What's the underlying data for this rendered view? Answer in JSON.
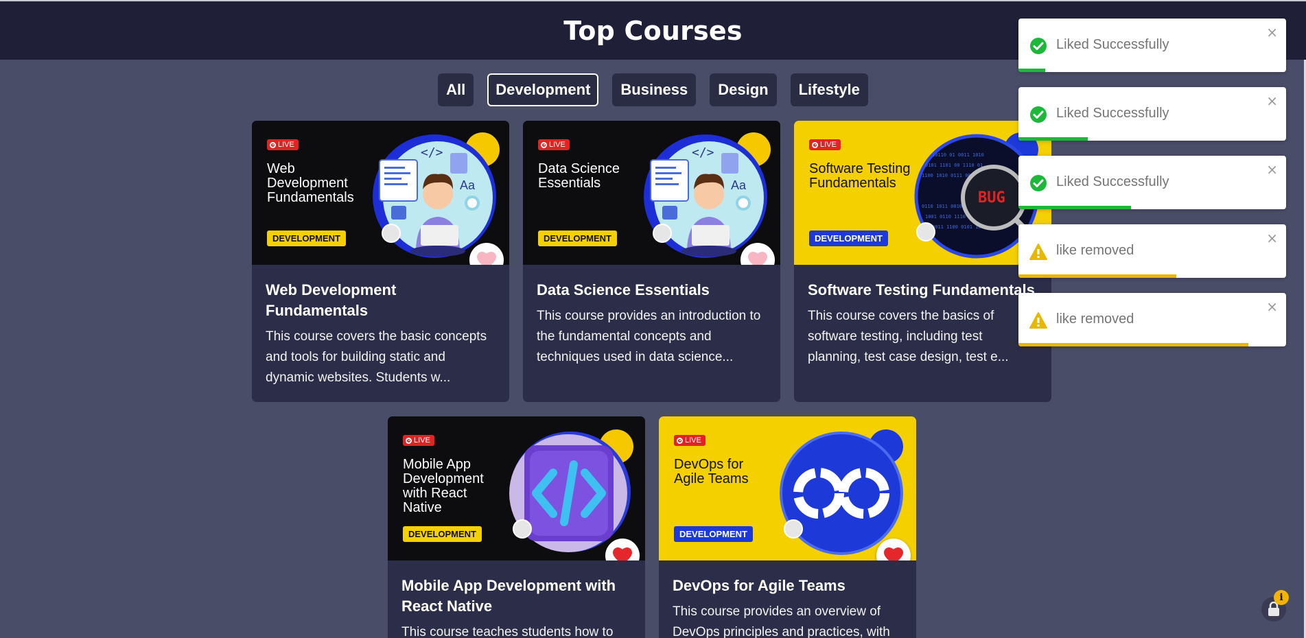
{
  "header": {
    "title": "Top Courses"
  },
  "filters": [
    {
      "label": "All",
      "active": false
    },
    {
      "label": "Development",
      "active": true
    },
    {
      "label": "Business",
      "active": false
    },
    {
      "label": "Design",
      "active": false
    },
    {
      "label": "Lifestyle",
      "active": false
    }
  ],
  "courses": [
    {
      "live": "LIVE",
      "thumb_title": "Web Development Fundamentals",
      "tag": "DEVELOPMENT",
      "title": "Web Development Fundamentals",
      "desc": "This course covers the basic concepts and tools for building static and dynamic websites. Students w...",
      "liked": false,
      "icon": "developer-illustration-icon"
    },
    {
      "live": "LIVE",
      "thumb_title": "Data Science Essentials",
      "tag": "DEVELOPMENT",
      "title": "Data Science Essentials",
      "desc": "This course provides an introduction to the fundamental concepts and techniques used in data science...",
      "liked": false,
      "icon": "developer-illustration-icon"
    },
    {
      "live": "LIVE",
      "thumb_title": "Software Testing Fundamentals",
      "tag": "DEVELOPMENT",
      "title": "Software Testing Fundamentals",
      "desc": "This course covers the basics of software testing, including test planning, test case design, test e...",
      "liked": false,
      "icon": "magnifier-bug-icon",
      "art_text": "BUG"
    },
    {
      "live": "LIVE",
      "thumb_title": "Mobile App Development with React Native",
      "tag": "DEVELOPMENT",
      "title": "Mobile App Development with React Native",
      "desc": "This course teaches students how to",
      "liked": true,
      "icon": "code-brackets-icon"
    },
    {
      "live": "LIVE",
      "thumb_title": "DevOps for Agile Teams",
      "tag": "DEVELOPMENT",
      "title": "DevOps for Agile Teams",
      "desc": "This course provides an overview of DevOps principles and practices, with",
      "liked": true,
      "icon": "devops-infinity-icon"
    }
  ],
  "toasts": [
    {
      "message": "Liked Successfully",
      "type": "success",
      "progress": 0.1
    },
    {
      "message": "Liked Successfully",
      "type": "success",
      "progress": 0.26
    },
    {
      "message": "Liked Successfully",
      "type": "success",
      "progress": 0.42
    },
    {
      "message": "like removed",
      "type": "warning",
      "progress": 0.59
    },
    {
      "message": "like removed",
      "type": "warning",
      "progress": 0.86
    }
  ],
  "toast_close": "×",
  "info_badge": "i",
  "colors": {
    "header_bg": "#1f2038",
    "page_bg": "#4a4d68",
    "card_bg": "#2c2d48",
    "success": "#1db73a",
    "warning": "#e8b800",
    "heart_active": "#e5262b",
    "heart_inactive": "#f8b6c3"
  }
}
